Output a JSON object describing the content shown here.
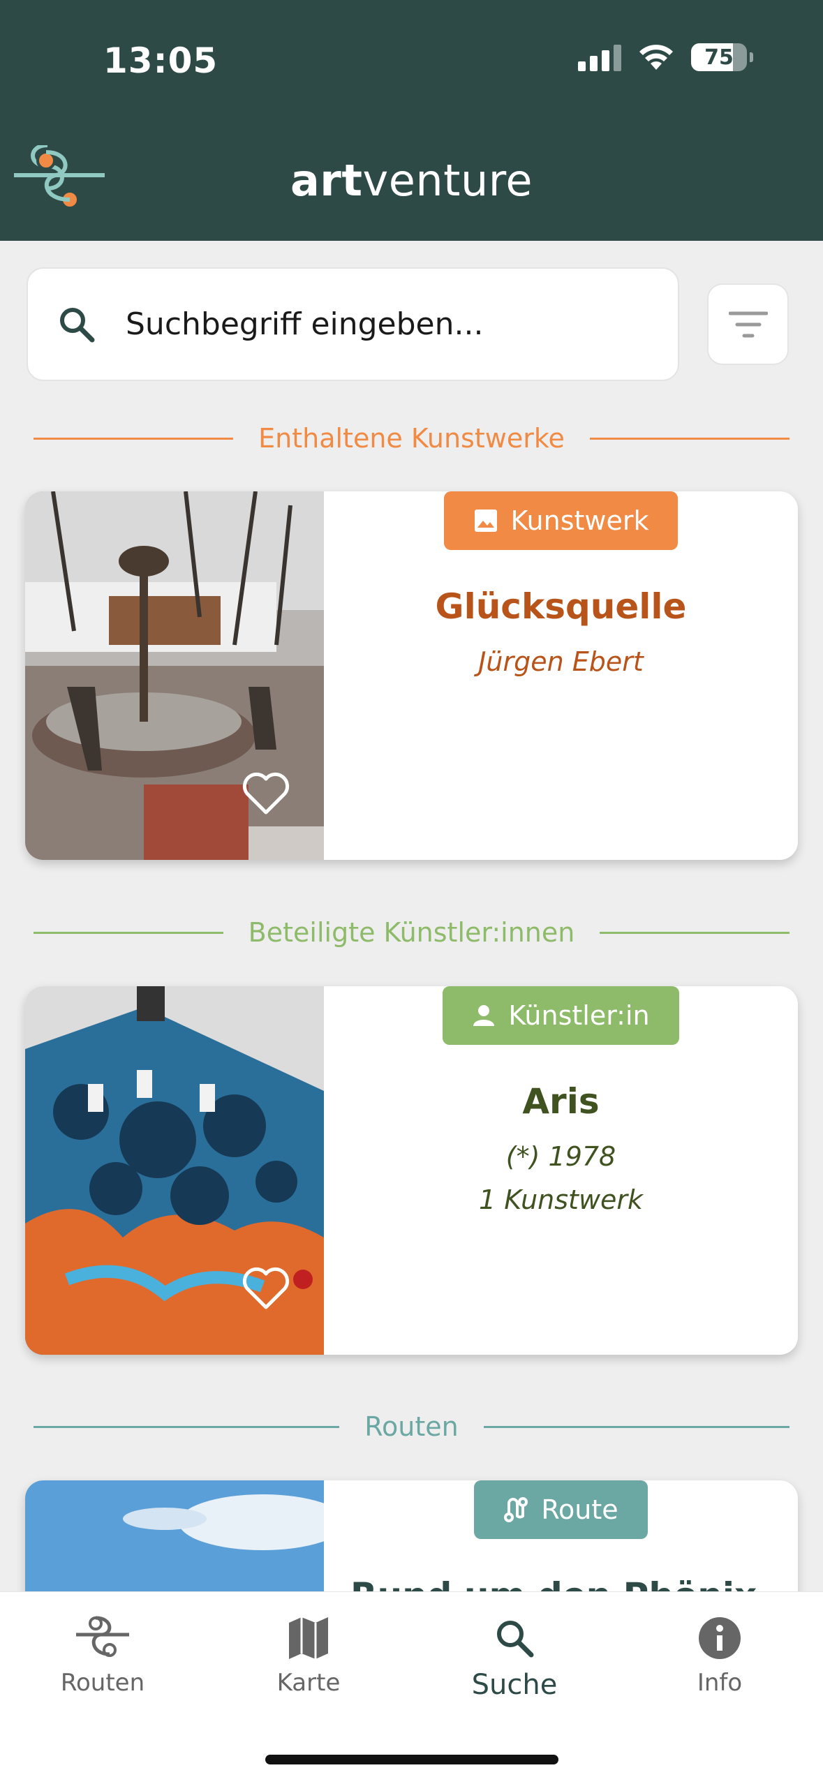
{
  "status_bar": {
    "time": "13:05",
    "battery": "75"
  },
  "header": {
    "brand_bold": "art",
    "brand_light": "venture"
  },
  "search": {
    "placeholder": "Suchbegriff eingeben..."
  },
  "sections": {
    "artworks": "Enthaltene Kunstwerke",
    "artists": "Beteiligte Künstler:innen",
    "routes": "Routen"
  },
  "artwork_card": {
    "tag": "Kunstwerk",
    "title": "Glücksquelle",
    "artist": "Jürgen Ebert"
  },
  "artist_card": {
    "tag": "Künstler:in",
    "title": "Aris",
    "born": "(*) 1978",
    "count": "1 Kunstwerk"
  },
  "route_card": {
    "tag": "Route",
    "title": "Rund um den Phönix-See"
  },
  "bottom_nav": [
    {
      "label": "Routen",
      "icon": "route-logo-icon"
    },
    {
      "label": "Karte",
      "icon": "map-icon"
    },
    {
      "label": "Suche",
      "icon": "search-icon"
    },
    {
      "label": "Info",
      "icon": "info-icon"
    }
  ],
  "colors": {
    "header": "#2d4a47",
    "artwork_accent": "#f08a44",
    "artwork_title": "#b8541a",
    "artist_accent": "#8ebb6a",
    "artist_title": "#3f5220",
    "route_accent": "#6ca8a3"
  }
}
